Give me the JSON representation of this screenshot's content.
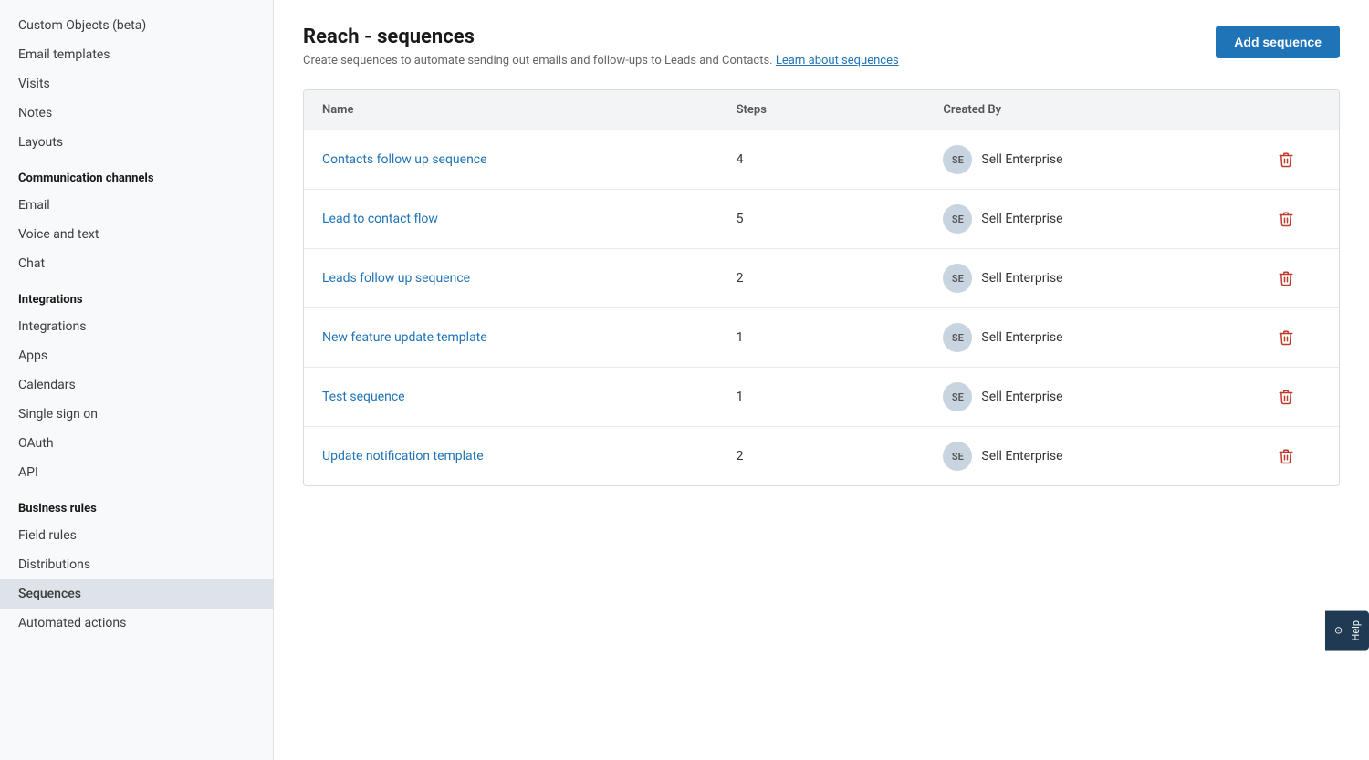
{
  "sidebar": {
    "items_top": [
      {
        "id": "custom-objects",
        "label": "Custom Objects (beta)",
        "active": false
      },
      {
        "id": "email-templates",
        "label": "Email templates",
        "active": false
      },
      {
        "id": "visits",
        "label": "Visits",
        "active": false
      },
      {
        "id": "notes",
        "label": "Notes",
        "active": false
      },
      {
        "id": "layouts",
        "label": "Layouts",
        "active": false
      }
    ],
    "sections": [
      {
        "id": "communication-channels",
        "label": "Communication channels",
        "items": [
          {
            "id": "email",
            "label": "Email",
            "active": false
          },
          {
            "id": "voice-and-text",
            "label": "Voice and text",
            "active": false
          },
          {
            "id": "chat",
            "label": "Chat",
            "active": false
          }
        ]
      },
      {
        "id": "integrations",
        "label": "Integrations",
        "items": [
          {
            "id": "integrations",
            "label": "Integrations",
            "active": false
          },
          {
            "id": "apps",
            "label": "Apps",
            "active": false
          },
          {
            "id": "calendars",
            "label": "Calendars",
            "active": false
          },
          {
            "id": "single-sign-on",
            "label": "Single sign on",
            "active": false
          },
          {
            "id": "oauth",
            "label": "OAuth",
            "active": false
          },
          {
            "id": "api",
            "label": "API",
            "active": false
          }
        ]
      },
      {
        "id": "business-rules",
        "label": "Business rules",
        "items": [
          {
            "id": "field-rules",
            "label": "Field rules",
            "active": false
          },
          {
            "id": "distributions",
            "label": "Distributions",
            "active": false
          },
          {
            "id": "sequences",
            "label": "Sequences",
            "active": true
          },
          {
            "id": "automated-actions",
            "label": "Automated actions",
            "active": false
          }
        ]
      }
    ]
  },
  "page": {
    "title": "Reach - sequences",
    "subtitle": "Create sequences to automate sending out emails and follow-ups to Leads and Contacts.",
    "learn_link": "Learn about sequences",
    "add_button": "Add sequence"
  },
  "table": {
    "columns": [
      {
        "id": "name",
        "label": "Name"
      },
      {
        "id": "steps",
        "label": "Steps"
      },
      {
        "id": "created_by",
        "label": "Created By"
      },
      {
        "id": "action",
        "label": ""
      }
    ],
    "rows": [
      {
        "id": 1,
        "name": "Contacts follow up sequence",
        "steps": "4",
        "created_by": "Sell Enterprise",
        "avatar": "SE"
      },
      {
        "id": 2,
        "name": "Lead to contact flow",
        "steps": "5",
        "created_by": "Sell Enterprise",
        "avatar": "SE"
      },
      {
        "id": 3,
        "name": "Leads follow up sequence",
        "steps": "2",
        "created_by": "Sell Enterprise",
        "avatar": "SE"
      },
      {
        "id": 4,
        "name": "New feature update template",
        "steps": "1",
        "created_by": "Sell Enterprise",
        "avatar": "SE"
      },
      {
        "id": 5,
        "name": "Test sequence",
        "steps": "1",
        "created_by": "Sell Enterprise",
        "avatar": "SE"
      },
      {
        "id": 6,
        "name": "Update notification template",
        "steps": "2",
        "created_by": "Sell Enterprise",
        "avatar": "SE"
      }
    ]
  },
  "help_widget": {
    "label": "Help"
  }
}
